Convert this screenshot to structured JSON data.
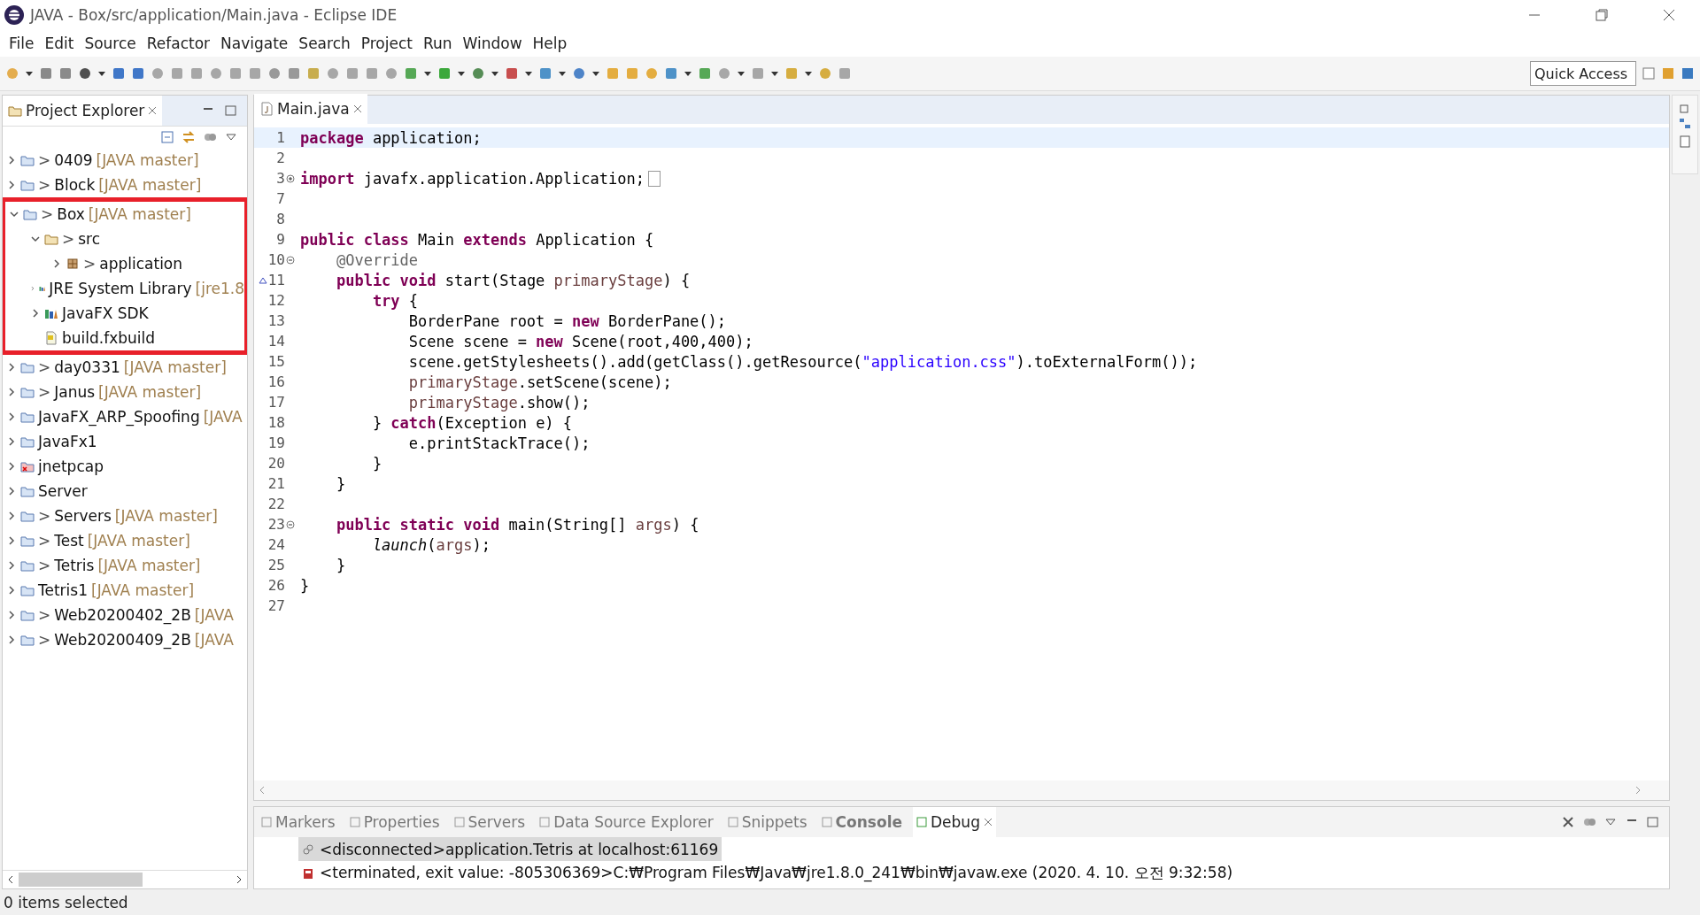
{
  "window": {
    "title": "JAVA - Box/src/application/Main.java - Eclipse IDE"
  },
  "menu": [
    "File",
    "Edit",
    "Source",
    "Refactor",
    "Navigate",
    "Search",
    "Project",
    "Run",
    "Window",
    "Help"
  ],
  "quick_access": {
    "placeholder": "Quick Access"
  },
  "project_explorer": {
    "title": "Project Explorer",
    "items": [
      {
        "kind": "project",
        "prefix": ">",
        "label": "0409",
        "tag": "[JAVA master]",
        "expanded": false
      },
      {
        "kind": "project",
        "prefix": ">",
        "label": "Block",
        "tag": "[JAVA master]",
        "expanded": false
      },
      {
        "kind": "project",
        "prefix": ">",
        "label": "Box",
        "tag": "[JAVA master]",
        "expanded": true,
        "highlighted": true,
        "children": [
          {
            "kind": "folder",
            "prefix": ">",
            "label": "src",
            "expanded": true,
            "children": [
              {
                "kind": "package",
                "prefix": ">",
                "label": "application",
                "expanded": false
              }
            ]
          },
          {
            "kind": "library",
            "label": "JRE System Library",
            "tag": "[jre1.8",
            "expanded": false
          },
          {
            "kind": "library",
            "label": "JavaFX SDK",
            "expanded": false
          },
          {
            "kind": "file",
            "label": "build.fxbuild"
          }
        ]
      },
      {
        "kind": "project",
        "prefix": ">",
        "label": "day0331",
        "tag": "[JAVA master]",
        "expanded": false
      },
      {
        "kind": "project",
        "prefix": ">",
        "label": "Janus",
        "tag": "[JAVA master]",
        "expanded": false
      },
      {
        "kind": "project",
        "label": "JavaFX_ARP_Spoofing",
        "tag": "[JAVA",
        "expanded": false
      },
      {
        "kind": "project",
        "label": "JavaFx1",
        "expanded": false
      },
      {
        "kind": "project",
        "label": "jnetpcap",
        "expanded": false,
        "error": true
      },
      {
        "kind": "project",
        "label": "Server",
        "expanded": false
      },
      {
        "kind": "project",
        "prefix": ">",
        "label": "Servers",
        "tag": "[JAVA master]",
        "expanded": false
      },
      {
        "kind": "project",
        "prefix": ">",
        "label": "Test",
        "tag": "[JAVA master]",
        "expanded": false
      },
      {
        "kind": "project",
        "prefix": ">",
        "label": "Tetris",
        "tag": "[JAVA master]",
        "expanded": false
      },
      {
        "kind": "project",
        "label": "Tetris1",
        "tag": "[JAVA master]",
        "expanded": false
      },
      {
        "kind": "project",
        "prefix": ">",
        "label": "Web20200402_2B",
        "tag": "[JAVA",
        "expanded": false
      },
      {
        "kind": "project",
        "prefix": ">",
        "label": "Web20200409_2B",
        "tag": "[JAVA",
        "expanded": false
      }
    ]
  },
  "editor": {
    "tab": "Main.java",
    "lines": [
      {
        "n": "1",
        "current": true,
        "segs": [
          {
            "kind": "kw",
            "text": "package"
          },
          {
            "kind": "tx",
            "text": " application;"
          }
        ]
      },
      {
        "n": "2"
      },
      {
        "n": "3",
        "foldable": true,
        "folded": true,
        "segs": [
          {
            "kind": "kw",
            "text": "import"
          },
          {
            "kind": "tx",
            "text": " javafx.application.Application;"
          }
        ]
      },
      {
        "n": "7"
      },
      {
        "n": "8"
      },
      {
        "n": "9",
        "segs": [
          {
            "kind": "kw",
            "text": "public class"
          },
          {
            "kind": "tx",
            "text": " Main "
          },
          {
            "kind": "kw",
            "text": "extends"
          },
          {
            "kind": "tx",
            "text": " Application {"
          }
        ]
      },
      {
        "n": "10",
        "foldable": true,
        "folded": false,
        "segs": [
          {
            "kind": "ann",
            "text": "    @Override"
          }
        ]
      },
      {
        "n": "11",
        "override": true,
        "segs": [
          {
            "kind": "kw",
            "text": "    public void"
          },
          {
            "kind": "tx",
            "text": " start(Stage "
          },
          {
            "kind": "var",
            "text": "primaryStage"
          },
          {
            "kind": "tx",
            "text": ") {"
          }
        ]
      },
      {
        "n": "12",
        "segs": [
          {
            "kind": "kw",
            "text": "        try"
          },
          {
            "kind": "tx",
            "text": " {"
          }
        ]
      },
      {
        "n": "13",
        "segs": [
          {
            "kind": "tx",
            "text": "            BorderPane root = "
          },
          {
            "kind": "kw",
            "text": "new"
          },
          {
            "kind": "tx",
            "text": " BorderPane();"
          }
        ]
      },
      {
        "n": "14",
        "segs": [
          {
            "kind": "tx",
            "text": "            Scene scene = "
          },
          {
            "kind": "kw",
            "text": "new"
          },
          {
            "kind": "tx",
            "text": " Scene(root,400,400);"
          }
        ]
      },
      {
        "n": "15",
        "segs": [
          {
            "kind": "tx",
            "text": "            scene.getStylesheets().add(getClass().getResource("
          },
          {
            "kind": "str",
            "text": "\"application.css\""
          },
          {
            "kind": "tx",
            "text": ").toExternalForm());"
          }
        ]
      },
      {
        "n": "16",
        "segs": [
          {
            "kind": "var",
            "text": "            primaryStage"
          },
          {
            "kind": "tx",
            "text": ".setScene(scene);"
          }
        ]
      },
      {
        "n": "17",
        "segs": [
          {
            "kind": "var",
            "text": "            primaryStage"
          },
          {
            "kind": "tx",
            "text": ".show();"
          }
        ]
      },
      {
        "n": "18",
        "segs": [
          {
            "kind": "tx",
            "text": "        } "
          },
          {
            "kind": "kw",
            "text": "catch"
          },
          {
            "kind": "tx",
            "text": "(Exception e) {"
          }
        ]
      },
      {
        "n": "19",
        "segs": [
          {
            "kind": "tx",
            "text": "            e.printStackTrace();"
          }
        ]
      },
      {
        "n": "20",
        "segs": [
          {
            "kind": "tx",
            "text": "        }"
          }
        ]
      },
      {
        "n": "21",
        "segs": [
          {
            "kind": "tx",
            "text": "    }"
          }
        ]
      },
      {
        "n": "22"
      },
      {
        "n": "23",
        "foldable": true,
        "folded": false,
        "segs": [
          {
            "kind": "kw",
            "text": "    public static void"
          },
          {
            "kind": "tx",
            "text": " main(String[] "
          },
          {
            "kind": "var",
            "text": "args"
          },
          {
            "kind": "tx",
            "text": ") {"
          }
        ]
      },
      {
        "n": "24",
        "segs": [
          {
            "kind": "it",
            "text": "        launch"
          },
          {
            "kind": "tx",
            "text": "("
          },
          {
            "kind": "var",
            "text": "args"
          },
          {
            "kind": "tx",
            "text": ");"
          }
        ]
      },
      {
        "n": "25",
        "segs": [
          {
            "kind": "tx",
            "text": "    }"
          }
        ]
      },
      {
        "n": "26",
        "segs": [
          {
            "kind": "tx",
            "text": "}"
          }
        ]
      },
      {
        "n": "27"
      }
    ]
  },
  "bottom_panel": {
    "tabs": [
      {
        "label": "Markers",
        "selected": false,
        "bold": false
      },
      {
        "label": "Properties",
        "selected": false,
        "bold": false
      },
      {
        "label": "Servers",
        "selected": false,
        "bold": false
      },
      {
        "label": "Data Source Explorer",
        "selected": false,
        "bold": false
      },
      {
        "label": "Snippets",
        "selected": false,
        "bold": false
      },
      {
        "label": "Console",
        "selected": false,
        "bold": true
      },
      {
        "label": "Debug",
        "selected": true,
        "bold": false
      }
    ],
    "rows": [
      {
        "kind": "disconnected",
        "text": "<disconnected>application.Tetris at localhost:61169",
        "selected": true
      },
      {
        "kind": "terminated",
        "text": "<terminated, exit value: -805306369>C:₩Program Files₩Java₩jre1.8.0_241₩bin₩javaw.exe (2020. 4. 10. 오전 9:32:58)",
        "selected": false
      }
    ]
  },
  "status_bar": "0 items selected"
}
